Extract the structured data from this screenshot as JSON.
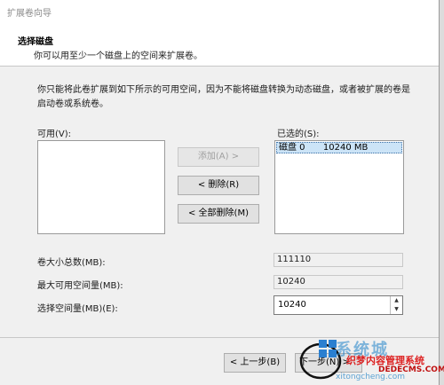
{
  "window": {
    "title": "扩展卷向导"
  },
  "header": {
    "title": "选择磁盘",
    "subtitle": "你可以用至少一个磁盘上的空间来扩展卷。"
  },
  "description": "你只能将此卷扩展到如下所示的可用空间，因为不能将磁盘转换为动态磁盘，或者被扩展的卷是启动卷或系统卷。",
  "available": {
    "label": "可用(V):",
    "items": []
  },
  "selected": {
    "label": "已选的(S):",
    "items": [
      {
        "disk": "磁盘 0",
        "size": "10240 MB"
      }
    ]
  },
  "buttons": {
    "add": "添加(A) >",
    "remove": "< 删除(R)",
    "remove_all": "< 全部删除(M)",
    "back": "< 上一步(B)",
    "next": "下一步(N) >"
  },
  "fields": {
    "total_label": "卷大小总数(MB):",
    "total_value": "111110",
    "max_label": "最大可用空间量(MB):",
    "max_value": "10240",
    "select_label": "选择空间量(MB)(E):",
    "select_value": "10240"
  },
  "watermark": {
    "text": "系统城",
    "site_name": "织梦内容管理系统",
    "url": "DEDECMS.COM",
    "url2": "xitongcheng.com"
  },
  "colors": {
    "selection": "#cce4f7",
    "window_bg": "#f0f0f0"
  }
}
